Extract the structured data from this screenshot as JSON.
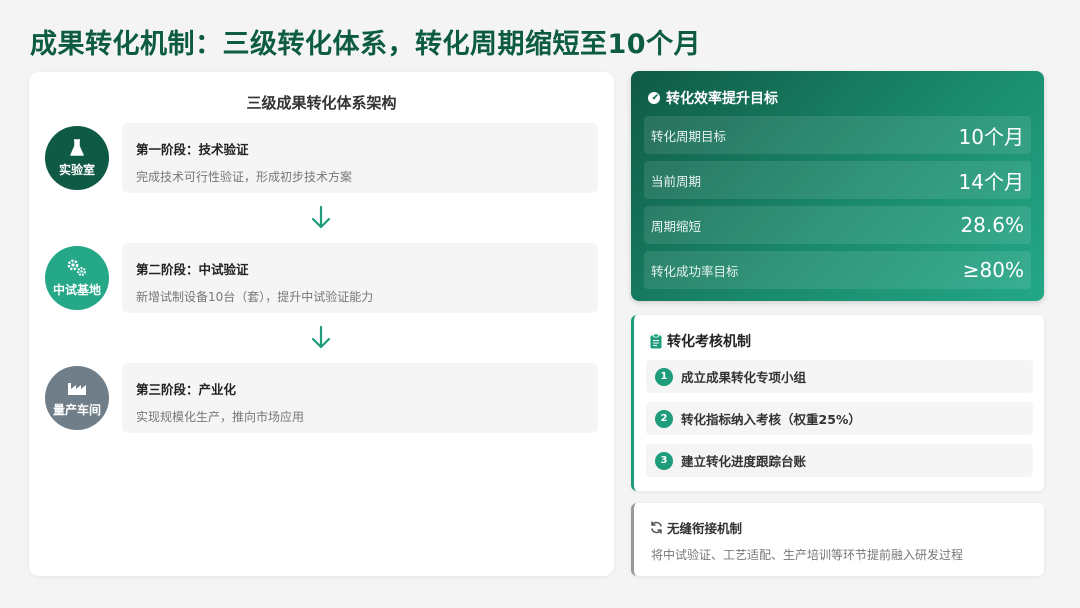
{
  "page": {
    "title": "成果转化机制：三级转化体系，转化周期缩短至10个月"
  },
  "architecture": {
    "title": "三级成果转化体系架构",
    "stages": [
      {
        "circle_label": "实验室",
        "icon": "flask-icon",
        "circle_color": "#0f5a45",
        "title": "第一阶段：技术验证",
        "desc": "完成技术可行性验证，形成初步技术方案"
      },
      {
        "circle_label": "中试基地",
        "icon": "gears-icon",
        "circle_color": "#24a888",
        "title": "第二阶段：中试验证",
        "desc": "新增试制设备10台（套），提升中试验证能力"
      },
      {
        "circle_label": "量产车间",
        "icon": "factory-icon",
        "circle_color": "#6f7e89",
        "title": "第三阶段：产业化",
        "desc": "实现规模化生产，推向市场应用"
      }
    ]
  },
  "efficiency": {
    "title": "转化效率提升目标",
    "icon": "gauge-icon",
    "rows": [
      {
        "label": "转化周期目标",
        "value": "10个月"
      },
      {
        "label": "当前周期",
        "value": "14个月"
      },
      {
        "label": "周期缩短",
        "value": "28.6%"
      },
      {
        "label": "转化成功率目标",
        "value": "≥80%"
      }
    ]
  },
  "assessment": {
    "title": "转化考核机制",
    "icon": "clipboard-icon",
    "items": [
      {
        "num": "1",
        "text": "成立成果转化专项小组"
      },
      {
        "num": "2",
        "text": "转化指标纳入考核（权重25%）"
      },
      {
        "num": "3",
        "text": "建立转化进度跟踪台账"
      }
    ]
  },
  "seamless": {
    "title": "无缝衔接机制",
    "icon": "sync-icon",
    "desc": "将中试验证、工艺适配、生产培训等环节提前融入研发过程"
  },
  "colors": {
    "title": "#0d5c3f",
    "accent": "#1e9c7c"
  }
}
